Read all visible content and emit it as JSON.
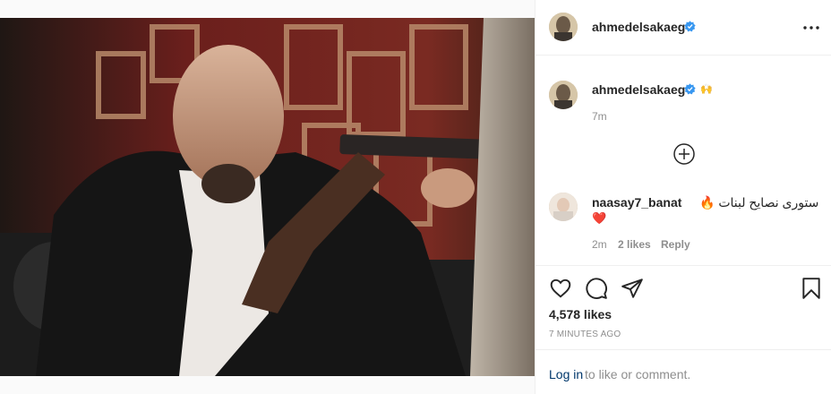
{
  "post": {
    "username": "ahmedelsakaeg",
    "caption_emoji": "🙌",
    "caption_time": "7m",
    "likes": "4,578 likes",
    "time_ago": "7 MINUTES AGO",
    "image_alt": "Man in black hoodie aiming a shotgun"
  },
  "comment": {
    "username": "naasay7_banat",
    "text": "ستورى نصايح لبنات 🔥",
    "emoji": "❤️",
    "time": "2m",
    "likes": "2 likes",
    "reply_label": "Reply"
  },
  "login": {
    "link": "Log in",
    "text": "to like or comment."
  },
  "colors": {
    "verified": "#3897f0",
    "link": "#00376b",
    "muted": "#8e8e8e",
    "heart": "#ed4956"
  }
}
